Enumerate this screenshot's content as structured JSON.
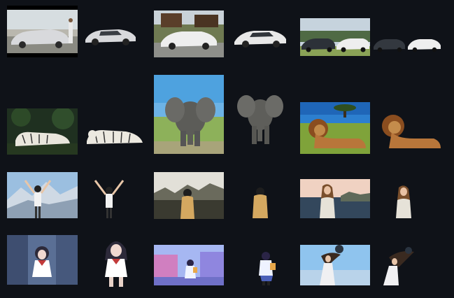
{
  "gallery": {
    "title": "",
    "pairs": [
      {
        "subject": "silver-concept-car",
        "original": "car-concept-original",
        "cutout": "car-concept-cutout"
      },
      {
        "subject": "white-supercar",
        "original": "supercar-original",
        "cutout": "supercar-cutout"
      },
      {
        "subject": "two-cars",
        "original": "two-cars-original",
        "cutout": "two-cars-cutout"
      },
      {
        "subject": "white-tiger",
        "original": "tiger-original",
        "cutout": "tiger-cutout"
      },
      {
        "subject": "elephant",
        "original": "elephant-original",
        "cutout": "elephant-cutout"
      },
      {
        "subject": "lion",
        "original": "lion-original",
        "cutout": "lion-cutout"
      },
      {
        "subject": "girl-arms-raised",
        "original": "girl-mountain-original",
        "cutout": "girl-mountain-cutout"
      },
      {
        "subject": "woman-from-behind",
        "original": "woman-back-original",
        "cutout": "woman-back-cutout"
      },
      {
        "subject": "woman-seaside",
        "original": "woman-sea-original",
        "cutout": "woman-sea-cutout"
      },
      {
        "subject": "anime-girl-mecha",
        "original": "anime-mecha-original",
        "cutout": "anime-mecha-cutout"
      },
      {
        "subject": "anime-girl-street",
        "original": "anime-street-original",
        "cutout": "anime-street-cutout"
      },
      {
        "subject": "girl-hair-wind",
        "original": "hair-wind-original",
        "cutout": "hair-wind-cutout"
      }
    ]
  },
  "colors": {
    "background": "#0f1218",
    "sky": "#8fc4ee",
    "grass": "#7aa24a",
    "car_silver": "#d9dbde"
  }
}
